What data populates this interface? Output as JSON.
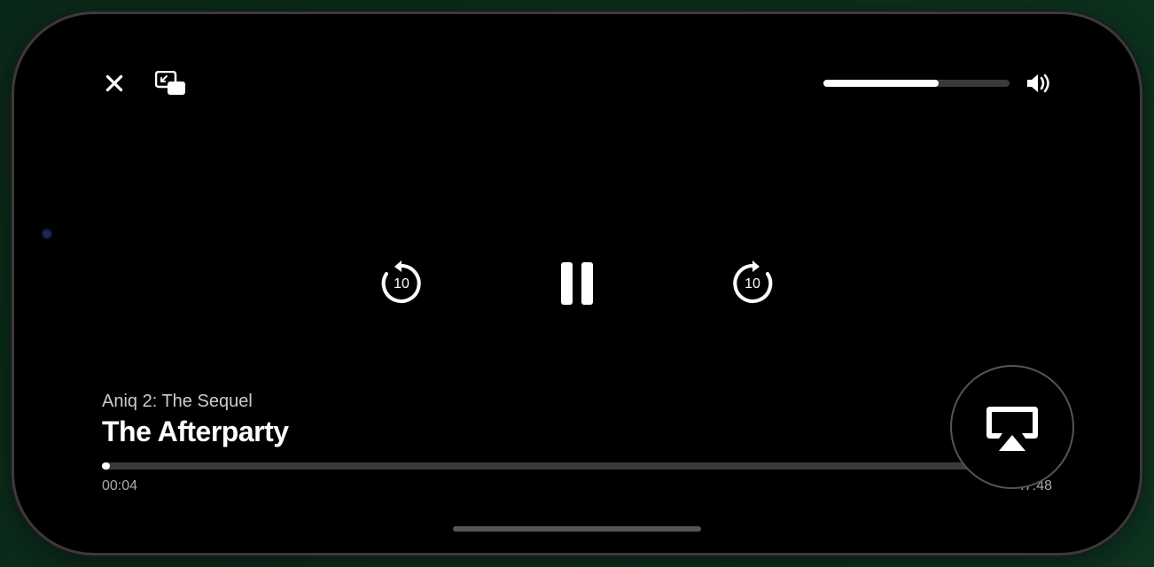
{
  "player": {
    "episode_name": "Aniq 2: The Sequel",
    "show_title": "The Afterparty",
    "elapsed_time": "00:04",
    "remaining_time": "-47:48",
    "progress_percent": 0.8,
    "volume_percent": 62,
    "skip_seconds": "10"
  },
  "icons": {
    "close": "close-icon",
    "pip": "picture-in-picture-icon",
    "volume": "volume-high-icon",
    "skip_back": "skip-back-10-icon",
    "skip_forward": "skip-forward-10-icon",
    "pause": "pause-icon",
    "airplay": "airplay-icon",
    "more": "more-options-icon"
  }
}
